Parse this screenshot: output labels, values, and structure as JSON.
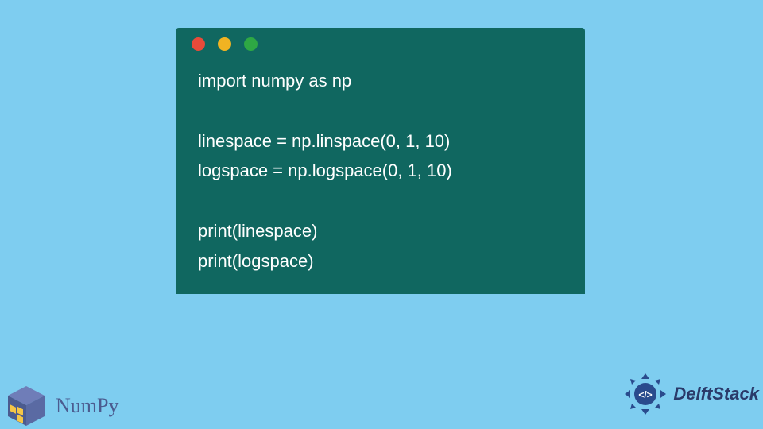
{
  "code": {
    "lines": [
      "import numpy as np",
      "",
      "linespace = np.linspace(0, 1, 10)",
      "logspace = np.logspace(0, 1, 10)",
      "",
      "print(linespace)",
      "print(logspace)"
    ]
  },
  "window": {
    "dots": [
      "red",
      "yellow",
      "green"
    ]
  },
  "logos": {
    "numpy": {
      "text": "NumPy"
    },
    "delft": {
      "text": "DelftStack"
    }
  },
  "colors": {
    "background": "#7ecdf0",
    "window": "#106760",
    "code_text": "#ffffff",
    "numpy_text": "#4b5b8f",
    "delft_text": "#2a3a6a"
  }
}
